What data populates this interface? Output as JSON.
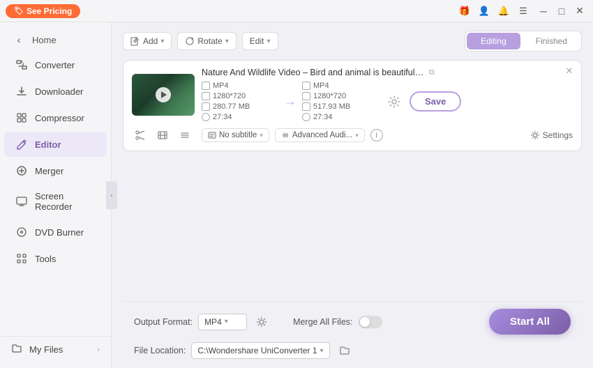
{
  "titlebar": {
    "pricing_label": "See Pricing",
    "icons": [
      "gift",
      "user",
      "bell",
      "menu"
    ],
    "window_controls": [
      "minimize",
      "maximize",
      "close"
    ]
  },
  "sidebar": {
    "home_label": "Home",
    "items": [
      {
        "id": "converter",
        "label": "Converter",
        "icon": "⇄"
      },
      {
        "id": "downloader",
        "label": "Downloader",
        "icon": "↓"
      },
      {
        "id": "compressor",
        "label": "Compressor",
        "icon": "⊞"
      },
      {
        "id": "editor",
        "label": "Editor",
        "icon": "✎",
        "active": true
      },
      {
        "id": "merger",
        "label": "Merger",
        "icon": "⊕"
      },
      {
        "id": "screen-recorder",
        "label": "Screen Recorder",
        "icon": "▣"
      },
      {
        "id": "dvd-burner",
        "label": "DVD Burner",
        "icon": "⊙"
      },
      {
        "id": "tools",
        "label": "Tools",
        "icon": "⊞"
      }
    ],
    "my_files_label": "My Files"
  },
  "toolbar": {
    "add_btn_label": "Add",
    "rotate_btn_label": "Rotate",
    "edit_dropdown_label": "Edit",
    "tabs": [
      {
        "id": "editing",
        "label": "Editing",
        "active": true
      },
      {
        "id": "finished",
        "label": "Finished",
        "active": false
      }
    ]
  },
  "video_card": {
    "title": "Nature And Wildlife Video – Bird and animal is beautiful creature on o...",
    "source": {
      "format": "MP4",
      "resolution": "1280*720",
      "size": "280.77 MB",
      "duration": "27:34"
    },
    "output": {
      "format": "MP4",
      "resolution": "1280*720",
      "size": "517.93 MB",
      "duration": "27:34"
    },
    "save_label": "Save",
    "subtitle_label": "No subtitle",
    "audio_label": "Advanced Audi...",
    "settings_label": "Settings"
  },
  "bottom_bar": {
    "output_format_label": "Output Format:",
    "output_format_value": "MP4",
    "file_location_label": "File Location:",
    "file_location_value": "C:\\Wondershare UniConverter 1",
    "merge_files_label": "Merge All Files:",
    "start_label": "Start All"
  }
}
